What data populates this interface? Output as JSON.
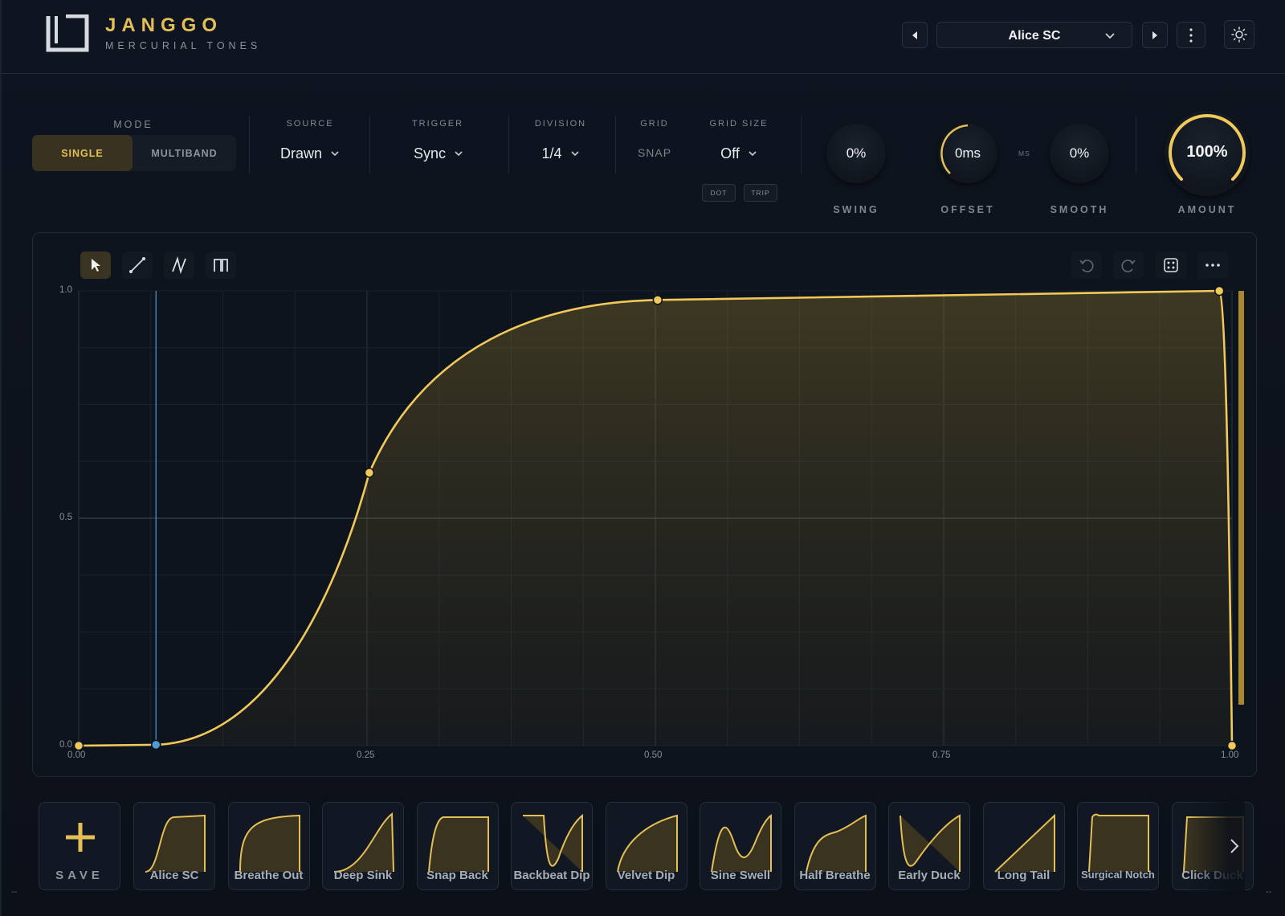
{
  "brand": {
    "name": "JANGGO",
    "tagline": "MERCURIAL TONES"
  },
  "header": {
    "preset_name": "Alice SC"
  },
  "controls": {
    "mode": {
      "label": "MODE",
      "options": [
        "SINGLE",
        "MULTIBAND"
      ],
      "selected": "SINGLE"
    },
    "source": {
      "label": "SOURCE",
      "value": "Drawn"
    },
    "trigger": {
      "label": "TRIGGER",
      "value": "Sync"
    },
    "division": {
      "label": "DIVISION",
      "value": "1/4"
    },
    "grid": {
      "label": "GRID",
      "value": "SNAP"
    },
    "grid_size": {
      "label": "GRID SIZE",
      "value": "Off",
      "dot": "DOT",
      "trip": "TRIP"
    },
    "swing": {
      "label": "SWING",
      "value": "0%",
      "level": 0
    },
    "offset": {
      "label": "OFFSET",
      "value": "0ms",
      "unit": "MS",
      "level": 0
    },
    "smooth": {
      "label": "SMOOTH",
      "value": "0%",
      "level": 0
    },
    "amount": {
      "label": "AMOUNT",
      "value": "100%",
      "level": 1.0
    }
  },
  "editor": {
    "y_ticks": [
      "1.0",
      "0.5",
      "0.0"
    ],
    "x_ticks": [
      "0.00",
      "0.25",
      "0.50",
      "0.75",
      "1.00"
    ],
    "playhead_x": 0.067,
    "curve_points": [
      {
        "x": 0.0,
        "y": 0.0
      },
      {
        "x": 0.067,
        "y": 0.002
      },
      {
        "x": 0.252,
        "y": 0.6
      },
      {
        "x": 0.502,
        "y": 0.98
      },
      {
        "x": 0.989,
        "y": 1.0
      },
      {
        "x": 1.0,
        "y": 0.0
      }
    ],
    "colors": {
      "curve": "#f1c95a",
      "playhead": "#4e9ad6"
    }
  },
  "presets": {
    "save_label": "SAVE",
    "items": [
      {
        "name": "Alice SC",
        "shape": "alice"
      },
      {
        "name": "Breathe Out",
        "shape": "breathe"
      },
      {
        "name": "Deep Sink",
        "shape": "deep"
      },
      {
        "name": "Snap Back",
        "shape": "snap"
      },
      {
        "name": "Backbeat Dip",
        "shape": "backbeat"
      },
      {
        "name": "Velvet Dip",
        "shape": "velvet"
      },
      {
        "name": "Sine Swell",
        "shape": "sine"
      },
      {
        "name": "Half Breathe",
        "shape": "half"
      },
      {
        "name": "Early Duck",
        "shape": "early"
      },
      {
        "name": "Long Tail",
        "shape": "long"
      },
      {
        "name": "Surgical Notch",
        "shape": "surgical"
      },
      {
        "name": "Click Duck",
        "shape": "click"
      }
    ]
  },
  "theme": {
    "accent": "#e4bf55",
    "bg": "#0c111a"
  }
}
